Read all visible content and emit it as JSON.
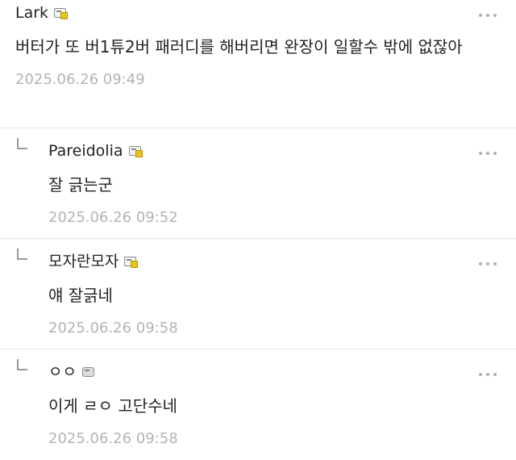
{
  "comments": [
    {
      "nick": "Lark",
      "text": "버터가 또 버1튜2버 패러디를 해버리면 완장이 일할수 밖에 없잖아",
      "time": "2025.06.26 09:49"
    },
    {
      "nick": "Pareidolia",
      "text": "잘 긁는군",
      "time": "2025.06.26 09:52"
    },
    {
      "nick": "모자란모자",
      "text": "얘 잘긁네",
      "time": "2025.06.26 09:58"
    },
    {
      "nick": "ㅇㅇ",
      "text": "이게 ㄹㅇ 고단수네",
      "time": "2025.06.26 09:58"
    }
  ],
  "icons": {
    "badge": "member-badge-icon",
    "more": "more-options-icon",
    "reply": "reply-arrow-icon"
  },
  "colors": {
    "text": "#222222",
    "timestamp": "#b3b3b3",
    "divider": "#e6e6e6",
    "badge_accent": "#e9c21f"
  }
}
